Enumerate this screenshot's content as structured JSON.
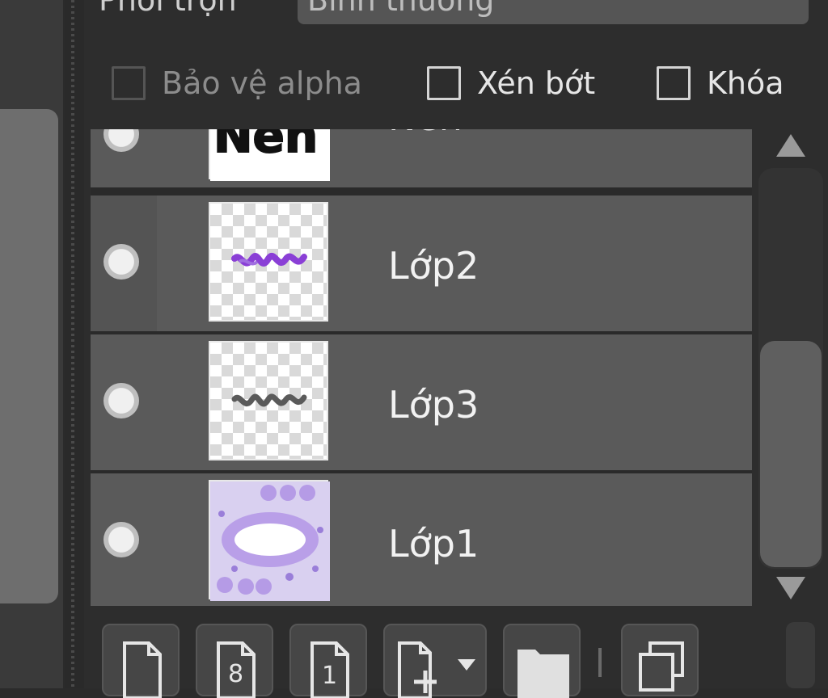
{
  "blend": {
    "label": "Phối trộn",
    "value": "Bình thường"
  },
  "options": {
    "protect_alpha": "Bảo vệ alpha",
    "clip": "Xén bớt",
    "lock": "Khóa"
  },
  "layers": [
    {
      "name": "Nền"
    },
    {
      "name": "Lớp2"
    },
    {
      "name": "Lớp3"
    },
    {
      "name": "Lớp1"
    }
  ],
  "toolbar": {
    "new_layer": "new-layer-icon",
    "new_8bit_layer": "new-8bit-layer-icon",
    "new_1bit_layer": "new-1bit-layer-icon",
    "add_layer_menu": "add-layer-dropdown-icon",
    "new_folder": "folder-icon",
    "duplicate": "duplicate-icon"
  },
  "colors": {
    "panel_bg": "#2d2d2d",
    "layer_bg": "#5a5a5a",
    "accent_purple": "#8a3fd6"
  }
}
